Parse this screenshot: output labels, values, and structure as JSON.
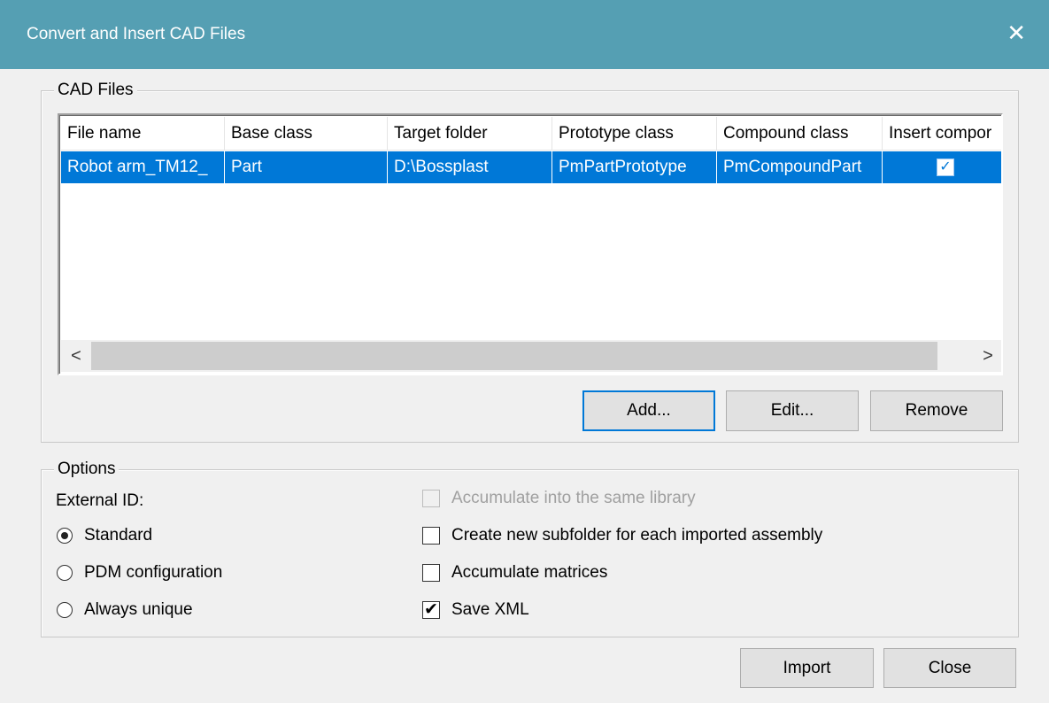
{
  "window": {
    "title": "Convert and Insert CAD Files",
    "close_glyph": "✕"
  },
  "cad_files": {
    "group_label": "CAD Files",
    "columns": [
      "File name",
      "Base class",
      "Target folder",
      "Prototype class",
      "Compound class",
      "Insert compor"
    ],
    "rows": [
      {
        "file_name": "Robot arm_TM12_",
        "base_class": "Part",
        "target_folder": "D:\\Bossplast",
        "prototype_class": "PmPartPrototype",
        "compound_class": "PmCompoundPart",
        "insert_component_checked": true,
        "check_glyph": "✓"
      }
    ],
    "scroll_left_glyph": "<",
    "scroll_right_glyph": ">",
    "buttons": {
      "add": "Add...",
      "edit": "Edit...",
      "remove": "Remove"
    }
  },
  "options": {
    "group_label": "Options",
    "external_id_label": "External ID:",
    "radios": [
      {
        "label": "Standard",
        "checked": true
      },
      {
        "label": "PDM configuration",
        "checked": false
      },
      {
        "label": "Always unique",
        "checked": false
      }
    ],
    "checkboxes": [
      {
        "label": "Accumulate into the same library",
        "checked": false,
        "disabled": true
      },
      {
        "label": "Create new subfolder for each imported assembly",
        "checked": false,
        "disabled": false
      },
      {
        "label": "Accumulate matrices",
        "checked": false,
        "disabled": false
      },
      {
        "label": "Save XML",
        "checked": true,
        "disabled": false,
        "check_glyph": "✔"
      }
    ]
  },
  "footer": {
    "import": "Import",
    "close": "Close"
  },
  "colors": {
    "titlebar": "#559fb3",
    "selection": "#0078d7"
  }
}
